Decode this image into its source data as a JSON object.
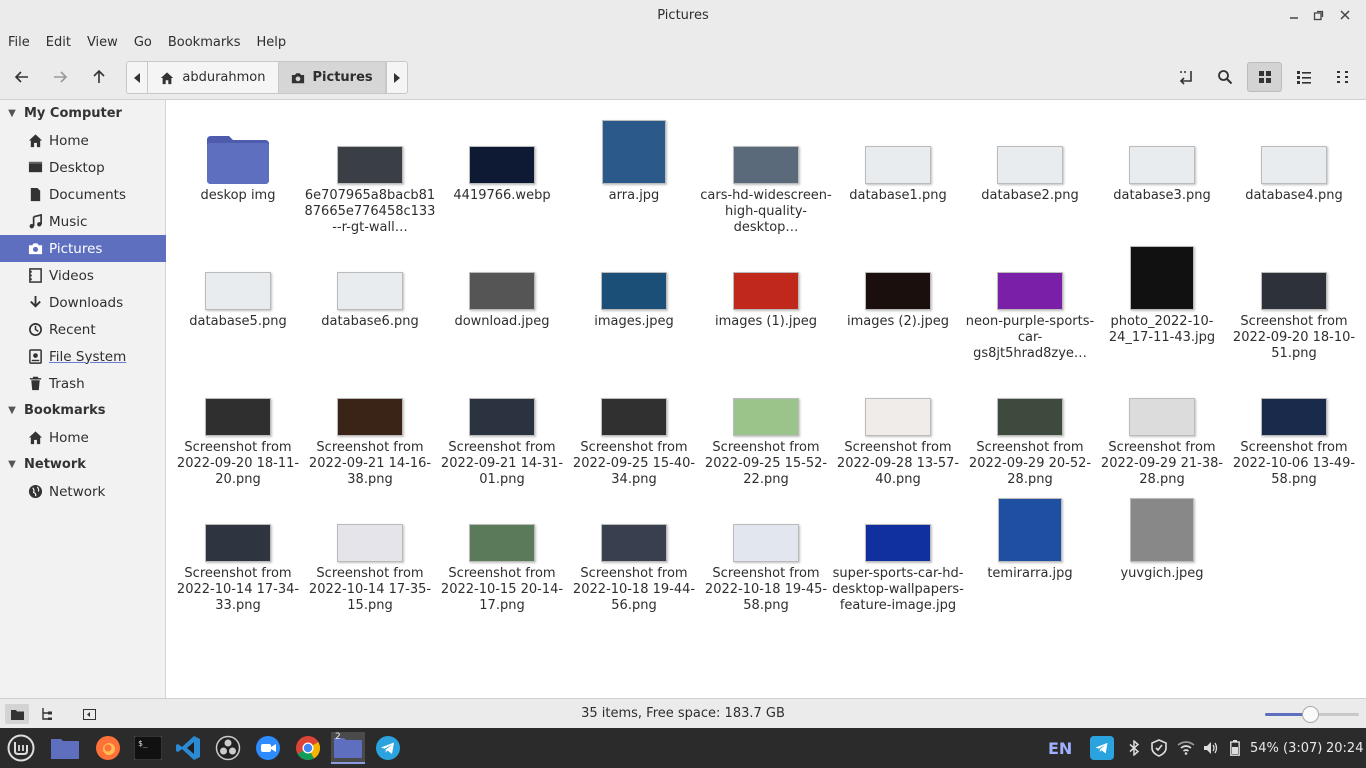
{
  "window": {
    "title": "Pictures"
  },
  "menu": [
    "File",
    "Edit",
    "View",
    "Go",
    "Bookmarks",
    "Help"
  ],
  "pathbar": {
    "home": "abdurahmon",
    "current": "Pictures"
  },
  "sidebar": {
    "sections": [
      {
        "title": "My Computer"
      },
      {
        "title": "Bookmarks"
      },
      {
        "title": "Network"
      }
    ],
    "items": [
      {
        "label": "Home",
        "icon": "home-icon"
      },
      {
        "label": "Desktop",
        "icon": "desktop-icon"
      },
      {
        "label": "Documents",
        "icon": "document-icon"
      },
      {
        "label": "Music",
        "icon": "music-icon"
      },
      {
        "label": "Pictures",
        "icon": "camera-icon",
        "selected": true
      },
      {
        "label": "Videos",
        "icon": "video-icon"
      },
      {
        "label": "Downloads",
        "icon": "download-icon"
      },
      {
        "label": "Recent",
        "icon": "clock-icon"
      },
      {
        "label": "File System",
        "icon": "drive-icon"
      },
      {
        "label": "Trash",
        "icon": "trash-icon"
      },
      {
        "label": "Home",
        "icon": "home-icon"
      },
      {
        "label": "Network",
        "icon": "globe-icon"
      }
    ]
  },
  "files": [
    {
      "name": "deskop img",
      "kind": "folder"
    },
    {
      "name": "6e707965a8bacb8187665e776458c133--r-gt-wall…",
      "kind": "image",
      "color": "#3a3f46"
    },
    {
      "name": "4419766.webp",
      "kind": "image",
      "color": "#0e1a33"
    },
    {
      "name": "arra.jpg",
      "kind": "image",
      "color": "#2b5a8a",
      "tall": true
    },
    {
      "name": "cars-hd-widescreen-high-quality-desktop…",
      "kind": "image",
      "color": "#5a6a7a"
    },
    {
      "name": "database1.png",
      "kind": "image",
      "color": "#e8ecef"
    },
    {
      "name": "database2.png",
      "kind": "image",
      "color": "#e8ecef"
    },
    {
      "name": "database3.png",
      "kind": "image",
      "color": "#e8ecef"
    },
    {
      "name": "database4.png",
      "kind": "image",
      "color": "#e8ecef"
    },
    {
      "name": "database5.png",
      "kind": "image",
      "color": "#e8ecef"
    },
    {
      "name": "database6.png",
      "kind": "image",
      "color": "#e8ecef"
    },
    {
      "name": "download.jpeg",
      "kind": "image",
      "color": "#555555"
    },
    {
      "name": "images.jpeg",
      "kind": "image",
      "color": "#1c4f78"
    },
    {
      "name": "images (1).jpeg",
      "kind": "image",
      "color": "#c0281c"
    },
    {
      "name": "images (2).jpeg",
      "kind": "image",
      "color": "#1a0f0c"
    },
    {
      "name": "neon-purple-sports-car-gs8jt5hrad8zye…",
      "kind": "image",
      "color": "#7a1fa8"
    },
    {
      "name": "photo_2022-10-24_17-11-43.jpg",
      "kind": "image",
      "color": "#111111",
      "tall": true
    },
    {
      "name": "Screenshot from 2022-09-20 18-10-51.png",
      "kind": "image",
      "color": "#2d323a"
    },
    {
      "name": "Screenshot from 2022-09-20 18-11-20.png",
      "kind": "image",
      "color": "#2f2f2f"
    },
    {
      "name": "Screenshot from 2022-09-21 14-16-38.png",
      "kind": "image",
      "color": "#3a2418"
    },
    {
      "name": "Screenshot from 2022-09-21 14-31-01.png",
      "kind": "image",
      "color": "#2c3340"
    },
    {
      "name": "Screenshot from 2022-09-25 15-40-34.png",
      "kind": "image",
      "color": "#303030"
    },
    {
      "name": "Screenshot from 2022-09-25 15-52-22.png",
      "kind": "image",
      "color": "#9ac48a"
    },
    {
      "name": "Screenshot from 2022-09-28 13-57-40.png",
      "kind": "image",
      "color": "#f0ecea"
    },
    {
      "name": "Screenshot from 2022-09-29 20-52-28.png",
      "kind": "image",
      "color": "#3e4a3e"
    },
    {
      "name": "Screenshot from 2022-09-29 21-38-28.png",
      "kind": "image",
      "color": "#dcdcdc"
    },
    {
      "name": "Screenshot from 2022-10-06 13-49-58.png",
      "kind": "image",
      "color": "#1a2a4a"
    },
    {
      "name": "Screenshot from 2022-10-14 17-34-33.png",
      "kind": "image",
      "color": "#2f3540"
    },
    {
      "name": "Screenshot from 2022-10-14 17-35-15.png",
      "kind": "image",
      "color": "#e4e4ea"
    },
    {
      "name": "Screenshot from 2022-10-15 20-14-17.png",
      "kind": "image",
      "color": "#5a7a5a"
    },
    {
      "name": "Screenshot from 2022-10-18 19-44-56.png",
      "kind": "image",
      "color": "#3a3f50"
    },
    {
      "name": "Screenshot from 2022-10-18 19-45-58.png",
      "kind": "image",
      "color": "#e2e6ee"
    },
    {
      "name": "super-sports-car-hd-desktop-wallpapers-feature-image.jpg",
      "kind": "image",
      "color": "#1030a0"
    },
    {
      "name": "temirarra.jpg",
      "kind": "image",
      "color": "#1f4fa0",
      "tall": true
    },
    {
      "name": "yuvgich.jpeg",
      "kind": "image",
      "color": "#888888",
      "tall": true
    }
  ],
  "status": {
    "text": "35 items, Free space: 183.7 GB",
    "zoom_fraction": 0.48
  },
  "taskbar": {
    "lang": "EN",
    "battery": "54% (3:07)",
    "clock": "20:24",
    "badge": "2"
  },
  "colors": {
    "accent": "#5f6fc0",
    "folder": "#5f6fc0",
    "panel": "#2b2b2b"
  }
}
